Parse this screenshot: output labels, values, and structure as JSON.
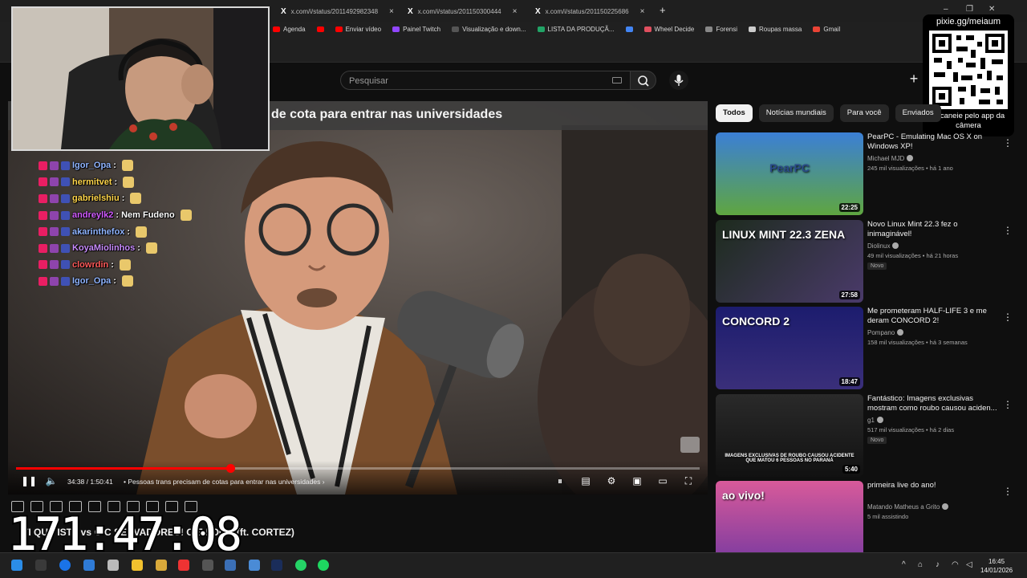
{
  "browser": {
    "tabs": [
      {
        "label": "x.com/i/status/2011492982348"
      },
      {
        "label": "x.com/i/status/201150300444"
      },
      {
        "label": "x.com/i/status/201150225686"
      }
    ],
    "new_tab": "+"
  },
  "bookmarks": [
    {
      "label": "Agenda",
      "color": "#ff0000"
    },
    {
      "label": "",
      "color": "#ff0000"
    },
    {
      "label": "Enviar vídeo",
      "color": "#ff0000"
    },
    {
      "label": "Painel Twitch",
      "color": "#9146ff"
    },
    {
      "label": "Visualização e down...",
      "color": "#555555"
    },
    {
      "label": "LISTA DA PRODUÇÃ...",
      "color": "#21a366"
    },
    {
      "label": "",
      "color": "#4285f4"
    },
    {
      "label": "Wheel Decide",
      "color": "#e04f5f"
    },
    {
      "label": "Forensi",
      "color": "#888888"
    },
    {
      "label": "Roupas massa",
      "color": "#cccccc"
    },
    {
      "label": "Gmail",
      "color": "#ea4335"
    }
  ],
  "search": {
    "placeholder": "Pesquisar"
  },
  "player": {
    "title": "de cota para entrar nas universidades",
    "time": "34:38 / 1:50:41",
    "chapter": "• Pessoas trans precisam de cotas para entrar nas universidades",
    "progress": 0.313
  },
  "chat": [
    {
      "user": "Igor_Opa",
      "color": "#8fb4ff",
      "msg": ":"
    },
    {
      "user": "hermitvet",
      "color": "#ffd54a",
      "msg": ":"
    },
    {
      "user": "gabrielshiu",
      "color": "#ffd54a",
      "msg": ":"
    },
    {
      "user": "andreylk2",
      "color": "#d15bff",
      "msg": ": Nem Fudeno"
    },
    {
      "user": "akarinthefox",
      "color": "#8fb4ff",
      "msg": ":"
    },
    {
      "user": "KoyaMiolinhos",
      "color": "#c98cff",
      "msg": ":"
    },
    {
      "user": "clowrdin",
      "color": "#ff5a5a",
      "msg": ":"
    },
    {
      "user": "Igor_Opa",
      "color": "#8fb4ff",
      "msg": ":"
    }
  ],
  "qr": {
    "url": "pixie.gg/meiaum",
    "hint": "escaneie pelo app da câmera"
  },
  "chips": [
    "Todos",
    "Notícias mundiais",
    "Para você",
    "Enviados"
  ],
  "recommendations": [
    {
      "title": "PearPC - Emulating Mac OS X on Windows XP!",
      "channel": "Michael MJD",
      "meta": "245 mil visualizações • há 1 ano",
      "duration": "22:25",
      "is_new": false,
      "thumb_text": "PearPC"
    },
    {
      "title": "Novo Linux Mint 22.3 fez o inimaginável!",
      "channel": "Diolinux",
      "meta": "49 mil visualizações • há 21 horas",
      "duration": "27:58",
      "is_new": true,
      "thumb_text": "LINUX MINT 22.3 ZENA"
    },
    {
      "title": "Me prometeram HALF-LIFE 3 e me deram CONCORD 2!",
      "channel": "Pompano",
      "meta": "158 mil visualizações • há 3 semanas",
      "duration": "18:47",
      "is_new": false,
      "thumb_text": "CONCORD 2"
    },
    {
      "title": "Fantástico: Imagens exclusivas mostram como roubo causou aciden...",
      "channel": "g1",
      "meta": "517 mil visualizações • há 2 dias",
      "duration": "5:40",
      "is_new": true,
      "thumb_text": "IMAGENS EXCLUSIVAS DE ROUBO CAUSOU ACIDENTE QUE MATOU 6 PESSOAS NO PARANÁ"
    },
    {
      "title": "primeira live do ano!",
      "channel": "Matando Matheus a Grito",
      "meta": "5 mil assistindo",
      "duration": "",
      "is_new": false,
      "thumb_text": "ao vivo!"
    }
  ],
  "below": {
    "title": "TI QUE ISTA vs O C SERVADORES! O E FOGO (ft. CORTEZ)",
    "clock": "171:47:08"
  },
  "new_label": "Novo",
  "taskbar": {
    "time": "16:45",
    "date": "14/01/2026"
  }
}
